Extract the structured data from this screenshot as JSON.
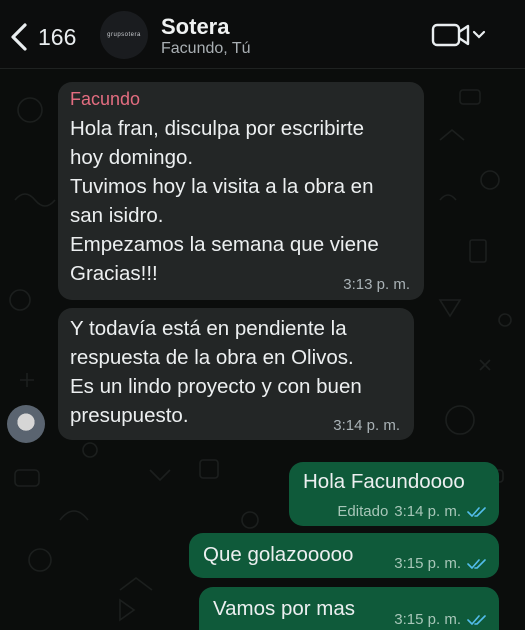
{
  "header": {
    "back_count": "166",
    "avatar_text": "grupsotera",
    "title": "Sotera",
    "participants": "Facundo, Tú"
  },
  "messages": [
    {
      "direction": "incoming",
      "sender": "Facundo",
      "text": "Hola fran, disculpa por escribirte\nhoy domingo.\nTuvimos hoy la visita a la obra en\nsan isidro.\nEmpezamos la semana que viene\nGracias!!!",
      "time": "3:13 p. m."
    },
    {
      "direction": "incoming",
      "text": "Y todavía está en pendiente la\nrespuesta de la obra en Olivos.\nEs un lindo proyecto y con buen\npresupuesto.",
      "time": "3:14 p. m."
    },
    {
      "direction": "outgoing",
      "text": "Hola Facundoooo",
      "edited": "Editado",
      "time": "3:14 p. m.",
      "status": "read"
    },
    {
      "direction": "outgoing",
      "text": "Que golazooooo",
      "time": "3:15 p. m.",
      "status": "read"
    },
    {
      "direction": "outgoing",
      "text": "Vamos por mas",
      "time": "3:15 p. m.",
      "status": "read"
    }
  ],
  "colors": {
    "incoming_bubble": "#232626",
    "outgoing_bubble": "#0f5a3a",
    "sender_name": "#e36d80",
    "read_ticks": "#53bdeb"
  }
}
